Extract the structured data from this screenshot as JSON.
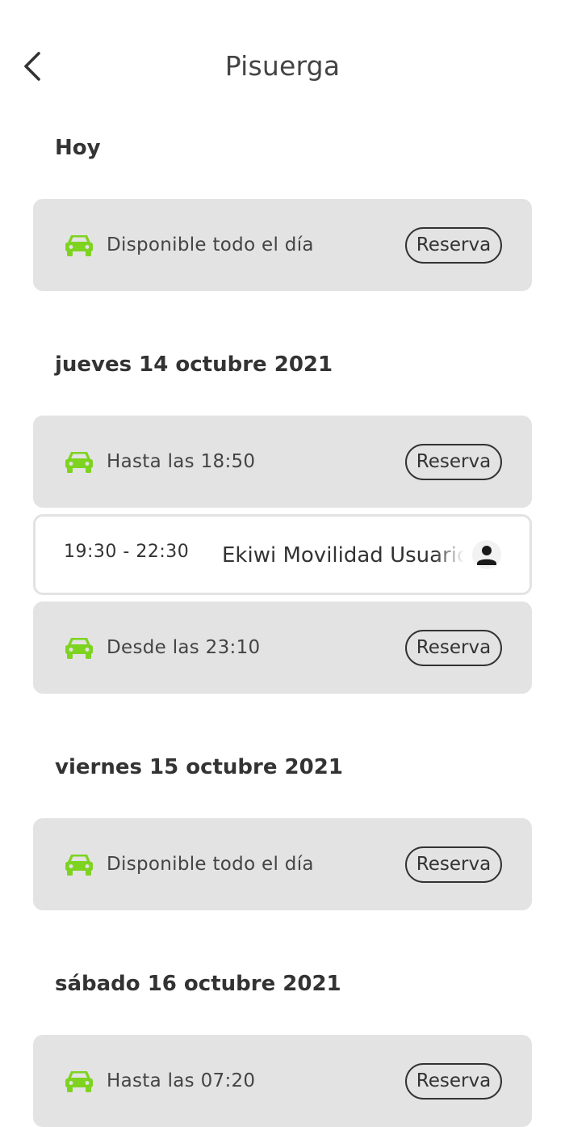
{
  "header": {
    "title": "Pisuerga",
    "back_icon": "chevron-left-icon"
  },
  "colors": {
    "available_icon": "#7ed321",
    "card_background": "#e3e3e3",
    "text": "#333333"
  },
  "days": [
    {
      "heading": "Hoy",
      "slots": [
        {
          "type": "available",
          "label": "Disponible todo el día",
          "button": "Reserva",
          "icon": "car-icon"
        }
      ]
    },
    {
      "heading": "jueves 14 octubre 2021",
      "slots": [
        {
          "type": "available",
          "label": "Hasta las 18:50",
          "button": "Reserva",
          "icon": "car-icon"
        },
        {
          "type": "booked",
          "time": "19:30 - 22:30",
          "user": "Ekiwi Movilidad Usuario",
          "icon": "person-icon"
        },
        {
          "type": "available",
          "label": "Desde las 23:10",
          "button": "Reserva",
          "icon": "car-icon"
        }
      ]
    },
    {
      "heading": "viernes 15 octubre 2021",
      "slots": [
        {
          "type": "available",
          "label": "Disponible todo el día",
          "button": "Reserva",
          "icon": "car-icon"
        }
      ]
    },
    {
      "heading": "sábado 16 octubre 2021",
      "slots": [
        {
          "type": "available",
          "label": "Hasta las 07:20",
          "button": "Reserva",
          "icon": "car-icon"
        }
      ]
    }
  ]
}
